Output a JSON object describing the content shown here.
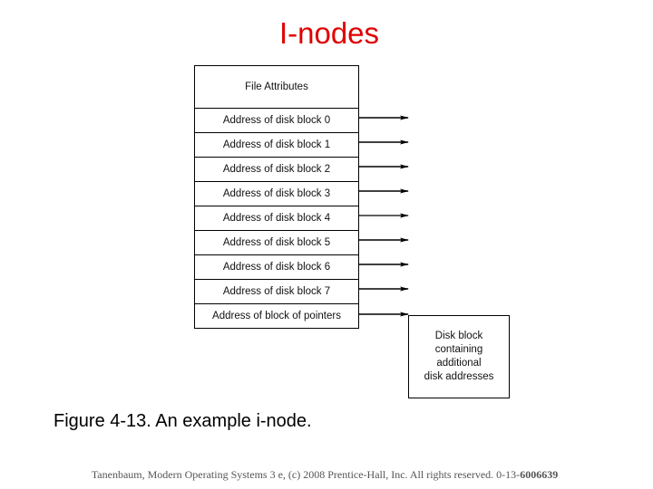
{
  "slide": {
    "title": "I-nodes",
    "title_color": "#e00000"
  },
  "inode": {
    "attributes_label": "File Attributes",
    "rows": [
      "Address of disk block 0",
      "Address of disk block 1",
      "Address of disk block 2",
      "Address of disk block 3",
      "Address of disk block 4",
      "Address of disk block 5",
      "Address of disk block 6",
      "Address of disk block 7",
      "Address of block of pointers"
    ]
  },
  "disk_block": {
    "lines": [
      "Disk block",
      "containing",
      "additional",
      "disk addresses"
    ]
  },
  "caption": "Figure 4-13. An example i-node.",
  "footer": {
    "text": "Tanenbaum, Modern Operating Systems 3 e, (c) 2008 Prentice-Hall, Inc. All rights reserved. 0-13-",
    "isbn_bold": "6006639"
  }
}
